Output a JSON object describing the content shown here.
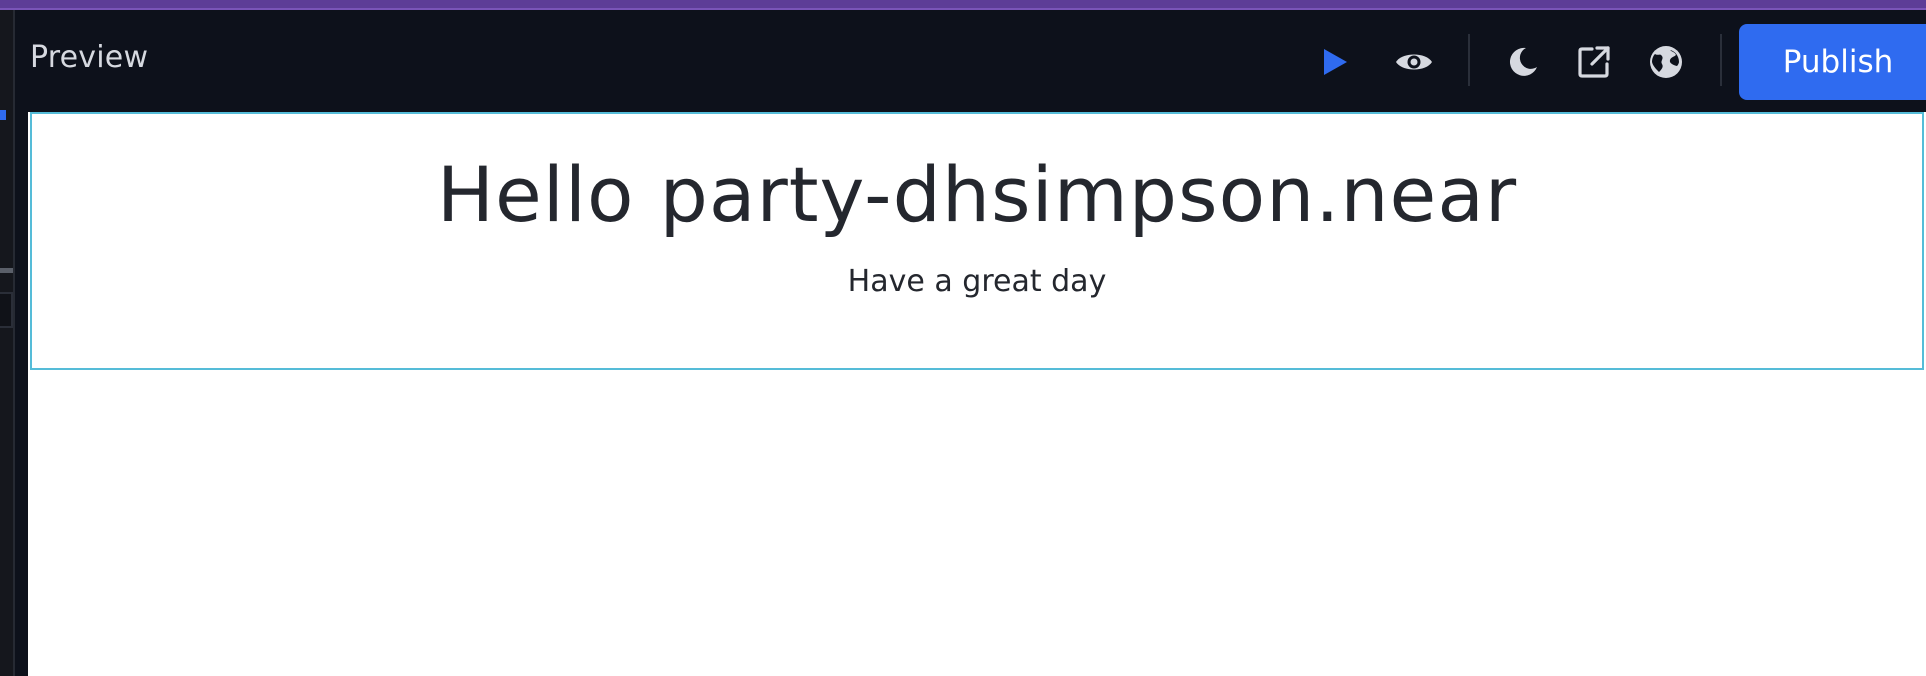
{
  "toolbar": {
    "title": "Preview",
    "publish_label": "Publish",
    "icons": [
      "play-icon",
      "eye-icon",
      "moon-icon",
      "external-link-icon",
      "globe-icon"
    ]
  },
  "widget": {
    "heading": "Hello party-dhsimpson.near",
    "subtitle": "Have a great day"
  },
  "colors": {
    "accent": "#2f6bf0",
    "toolbar_bg": "#0d111b",
    "top_strip": "#5d3d97",
    "selection_border": "#55bcd8"
  }
}
